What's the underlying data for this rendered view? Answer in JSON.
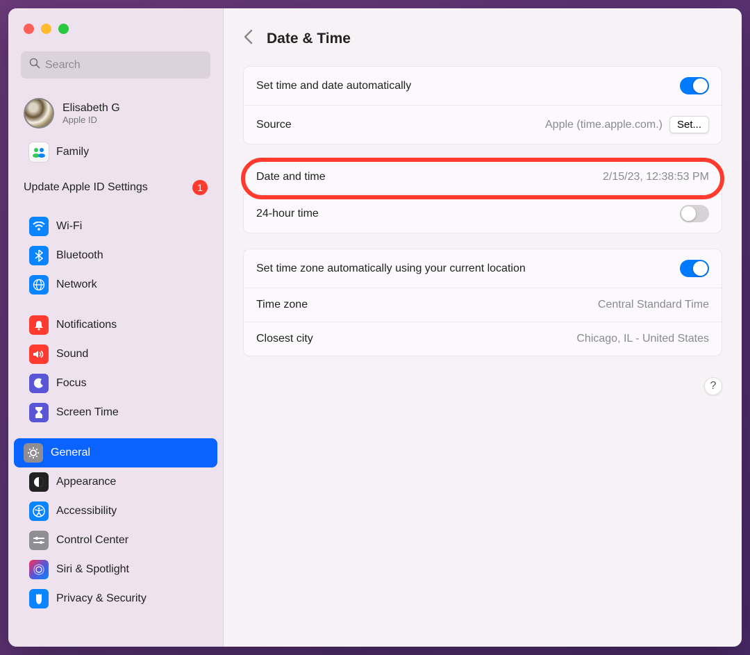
{
  "search": {
    "placeholder": "Search"
  },
  "user": {
    "name": "Elisabeth G",
    "sub": "Apple ID"
  },
  "family": {
    "label": "Family"
  },
  "update": {
    "text": "Update Apple ID Settings",
    "count": "1"
  },
  "sidebar_a": [
    {
      "label": "Wi-Fi"
    },
    {
      "label": "Bluetooth"
    },
    {
      "label": "Network"
    }
  ],
  "sidebar_b": [
    {
      "label": "Notifications"
    },
    {
      "label": "Sound"
    },
    {
      "label": "Focus"
    },
    {
      "label": "Screen Time"
    }
  ],
  "sidebar_c": [
    {
      "label": "General"
    },
    {
      "label": "Appearance"
    },
    {
      "label": "Accessibility"
    },
    {
      "label": "Control Center"
    },
    {
      "label": "Siri & Spotlight"
    },
    {
      "label": "Privacy & Security"
    }
  ],
  "page": {
    "title": "Date & Time"
  },
  "panel1": {
    "auto_label": "Set time and date automatically",
    "source_label": "Source",
    "source_value": "Apple (time.apple.com.)",
    "set_button": "Set..."
  },
  "panel2": {
    "dt_label": "Date and time",
    "dt_value": "2/15/23, 12:38:53 PM",
    "twentyfour_label": "24-hour time"
  },
  "panel3": {
    "auto_label": "Set time zone automatically using your current location",
    "tz_label": "Time zone",
    "tz_value": "Central Standard Time",
    "city_label": "Closest city",
    "city_value": "Chicago, IL - United States"
  },
  "help": "?"
}
